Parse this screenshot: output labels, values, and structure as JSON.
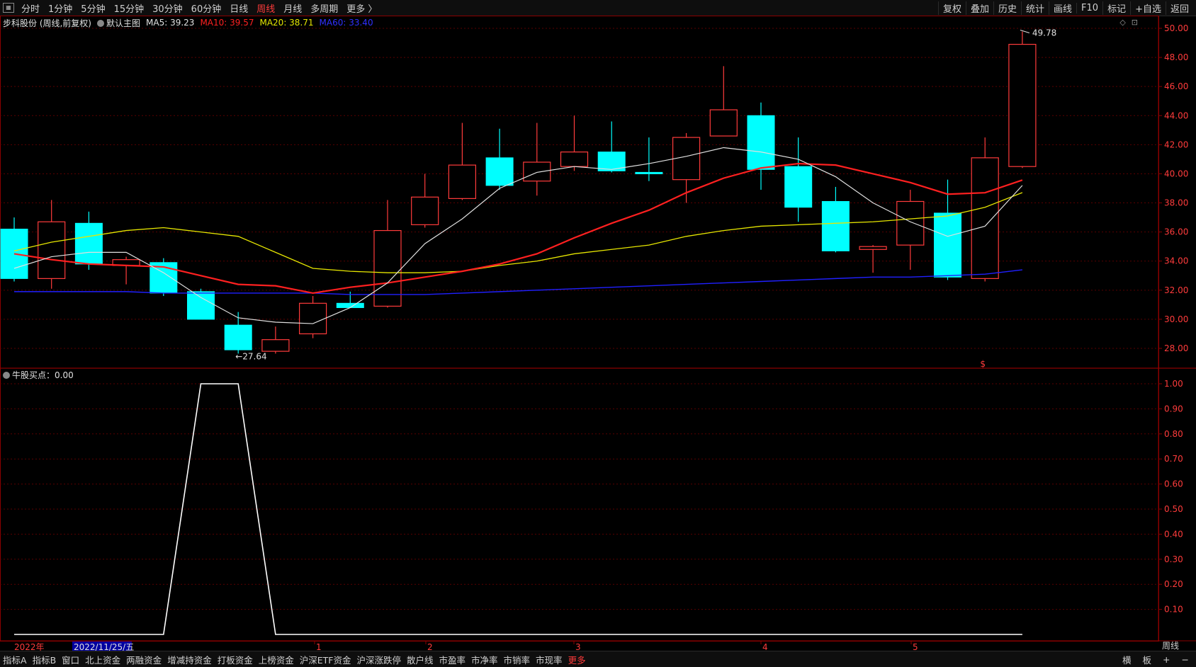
{
  "toolbar": {
    "periods": [
      "分时",
      "1分钟",
      "5分钟",
      "15分钟",
      "30分钟",
      "60分钟",
      "日线",
      "周线",
      "月线",
      "多周期",
      "更多 〉"
    ],
    "active_period": "周线",
    "right_items": [
      "复权",
      "叠加",
      "历史",
      "统计",
      "画线",
      "F10",
      "标记",
      "+自选",
      "返回"
    ]
  },
  "info": {
    "title": "步科股份 (周线,前复权)",
    "main_chart": "默认主图",
    "ma5": "MA5: 39.23",
    "ma10": "MA10: 39.57",
    "ma20": "MA20: 38.71",
    "ma60": "MA60: 33.40"
  },
  "sub_info": {
    "label": "牛股买点：0.00"
  },
  "annotations": {
    "high": "49.78",
    "low": "27.64",
    "marker": "$"
  },
  "x_labels": {
    "year": "2022年",
    "date": "2022/11/25/五",
    "m1": "1",
    "m2": "2",
    "m3": "3",
    "m4": "4",
    "m5": "5"
  },
  "period_label": "周线",
  "bottom_bar": {
    "items": [
      "指标A",
      "指标B",
      "窗口",
      "北上资金",
      "两融资金",
      "增减持资金",
      "打板资金",
      "上榜资金",
      "沪深ETF资金",
      "沪深涨跌停",
      "散户线",
      "市盈率",
      "市净率",
      "市销率",
      "市现率",
      "更多"
    ],
    "active": "更多",
    "right_items": [
      "横",
      "板",
      "+",
      "−"
    ]
  },
  "colors": {
    "up": "#ff3b3b",
    "down": "#00ffff",
    "ma5": "#e0e0e0",
    "ma10": "#ff2020",
    "ma20": "#e6e600",
    "ma60": "#2020ff",
    "axis": "#8b0000",
    "grid": "#5a0000"
  },
  "chart_data": [
    {
      "type": "candlestick",
      "title": "步科股份 (周线,前复权)",
      "ylim": [
        27,
        50.5
      ],
      "y_ticks": [
        28.0,
        30.0,
        32.0,
        34.0,
        36.0,
        38.0,
        40.0,
        42.0,
        44.0,
        46.0,
        48.0,
        50.0
      ],
      "x_ticks": [
        "2022年",
        "1",
        "2",
        "3",
        "4",
        "5"
      ],
      "candles": [
        {
          "o": 36.2,
          "c": 32.8,
          "h": 37.0,
          "l": 32.6
        },
        {
          "o": 32.8,
          "c": 36.7,
          "h": 38.2,
          "l": 32.1
        },
        {
          "o": 36.6,
          "c": 33.8,
          "h": 37.4,
          "l": 33.4
        },
        {
          "o": 33.7,
          "c": 34.1,
          "h": 34.3,
          "l": 32.4
        },
        {
          "o": 33.9,
          "c": 31.8,
          "h": 34.2,
          "l": 31.6
        },
        {
          "o": 31.9,
          "c": 30.0,
          "h": 32.1,
          "l": 30.0
        },
        {
          "o": 29.6,
          "c": 27.9,
          "h": 30.5,
          "l": 27.64
        },
        {
          "o": 27.8,
          "c": 28.6,
          "h": 29.5,
          "l": 27.64
        },
        {
          "o": 29.0,
          "c": 31.1,
          "h": 31.6,
          "l": 28.7
        },
        {
          "o": 31.1,
          "c": 30.8,
          "h": 31.9,
          "l": 30.8
        },
        {
          "o": 30.9,
          "c": 36.1,
          "h": 38.2,
          "l": 30.8
        },
        {
          "o": 36.5,
          "c": 38.4,
          "h": 40.0,
          "l": 36.3
        },
        {
          "o": 38.3,
          "c": 40.6,
          "h": 43.5,
          "l": 38.2
        },
        {
          "o": 41.1,
          "c": 39.2,
          "h": 43.1,
          "l": 38.9
        },
        {
          "o": 39.5,
          "c": 40.8,
          "h": 43.5,
          "l": 38.5
        },
        {
          "o": 40.5,
          "c": 41.5,
          "h": 44.0,
          "l": 40.2
        },
        {
          "o": 41.5,
          "c": 40.2,
          "h": 43.6,
          "l": 40.1
        },
        {
          "o": 40.1,
          "c": 40.0,
          "h": 42.5,
          "l": 39.5
        },
        {
          "o": 39.6,
          "c": 42.5,
          "h": 42.8,
          "l": 38.0
        },
        {
          "o": 42.6,
          "c": 44.4,
          "h": 47.4,
          "l": 42.6
        },
        {
          "o": 44.0,
          "c": 40.3,
          "h": 44.9,
          "l": 38.9
        },
        {
          "o": 40.5,
          "c": 37.7,
          "h": 42.5,
          "l": 36.7
        },
        {
          "o": 38.1,
          "c": 34.7,
          "h": 39.1,
          "l": 34.6
        },
        {
          "o": 34.8,
          "c": 35.0,
          "h": 35.1,
          "l": 33.2
        },
        {
          "o": 35.1,
          "c": 38.1,
          "h": 38.9,
          "l": 33.4
        },
        {
          "o": 37.3,
          "c": 32.9,
          "h": 39.6,
          "l": 32.7
        },
        {
          "o": 32.8,
          "c": 41.1,
          "h": 42.5,
          "l": 32.6
        },
        {
          "o": 40.5,
          "c": 48.9,
          "h": 49.78,
          "l": 40.4
        }
      ],
      "ma5": [
        33.5,
        34.3,
        34.6,
        34.6,
        33.2,
        31.5,
        30.1,
        29.8,
        29.7,
        30.8,
        32.5,
        35.2,
        36.9,
        39.0,
        40.1,
        40.5,
        40.3,
        40.7,
        41.2,
        41.8,
        41.5,
        41.0,
        39.8,
        38.0,
        36.7,
        35.7,
        36.4,
        39.2
      ],
      "ma10": [
        34.5,
        34.1,
        33.8,
        33.7,
        33.6,
        33.0,
        32.4,
        32.3,
        31.8,
        32.2,
        32.5,
        32.9,
        33.3,
        33.8,
        34.5,
        35.6,
        36.6,
        37.5,
        38.7,
        39.7,
        40.4,
        40.7,
        40.6,
        40.0,
        39.4,
        38.6,
        38.7,
        39.57
      ],
      "ma20": [
        34.7,
        35.3,
        35.7,
        36.1,
        36.3,
        36.0,
        35.7,
        34.6,
        33.5,
        33.3,
        33.2,
        33.2,
        33.3,
        33.7,
        34.0,
        34.5,
        34.8,
        35.1,
        35.7,
        36.1,
        36.4,
        36.5,
        36.6,
        36.7,
        36.9,
        37.1,
        37.7,
        38.71
      ],
      "ma60": [
        31.9,
        31.9,
        31.9,
        31.9,
        31.8,
        31.8,
        31.8,
        31.8,
        31.8,
        31.7,
        31.7,
        31.7,
        31.8,
        31.9,
        32.0,
        32.1,
        32.2,
        32.3,
        32.4,
        32.5,
        32.6,
        32.7,
        32.8,
        32.9,
        32.9,
        33.0,
        33.1,
        33.4
      ]
    },
    {
      "type": "line",
      "title": "牛股买点",
      "ylim": [
        0,
        1.05
      ],
      "y_ticks": [
        0.1,
        0.2,
        0.3,
        0.4,
        0.5,
        0.6,
        0.7,
        0.8,
        0.9,
        1.0
      ],
      "values": [
        0,
        0,
        0,
        0,
        0,
        1,
        1,
        0,
        0,
        0,
        0,
        0,
        0,
        0,
        0,
        0,
        0,
        0,
        0,
        0,
        0,
        0,
        0,
        0,
        0,
        0,
        0,
        0
      ]
    }
  ]
}
